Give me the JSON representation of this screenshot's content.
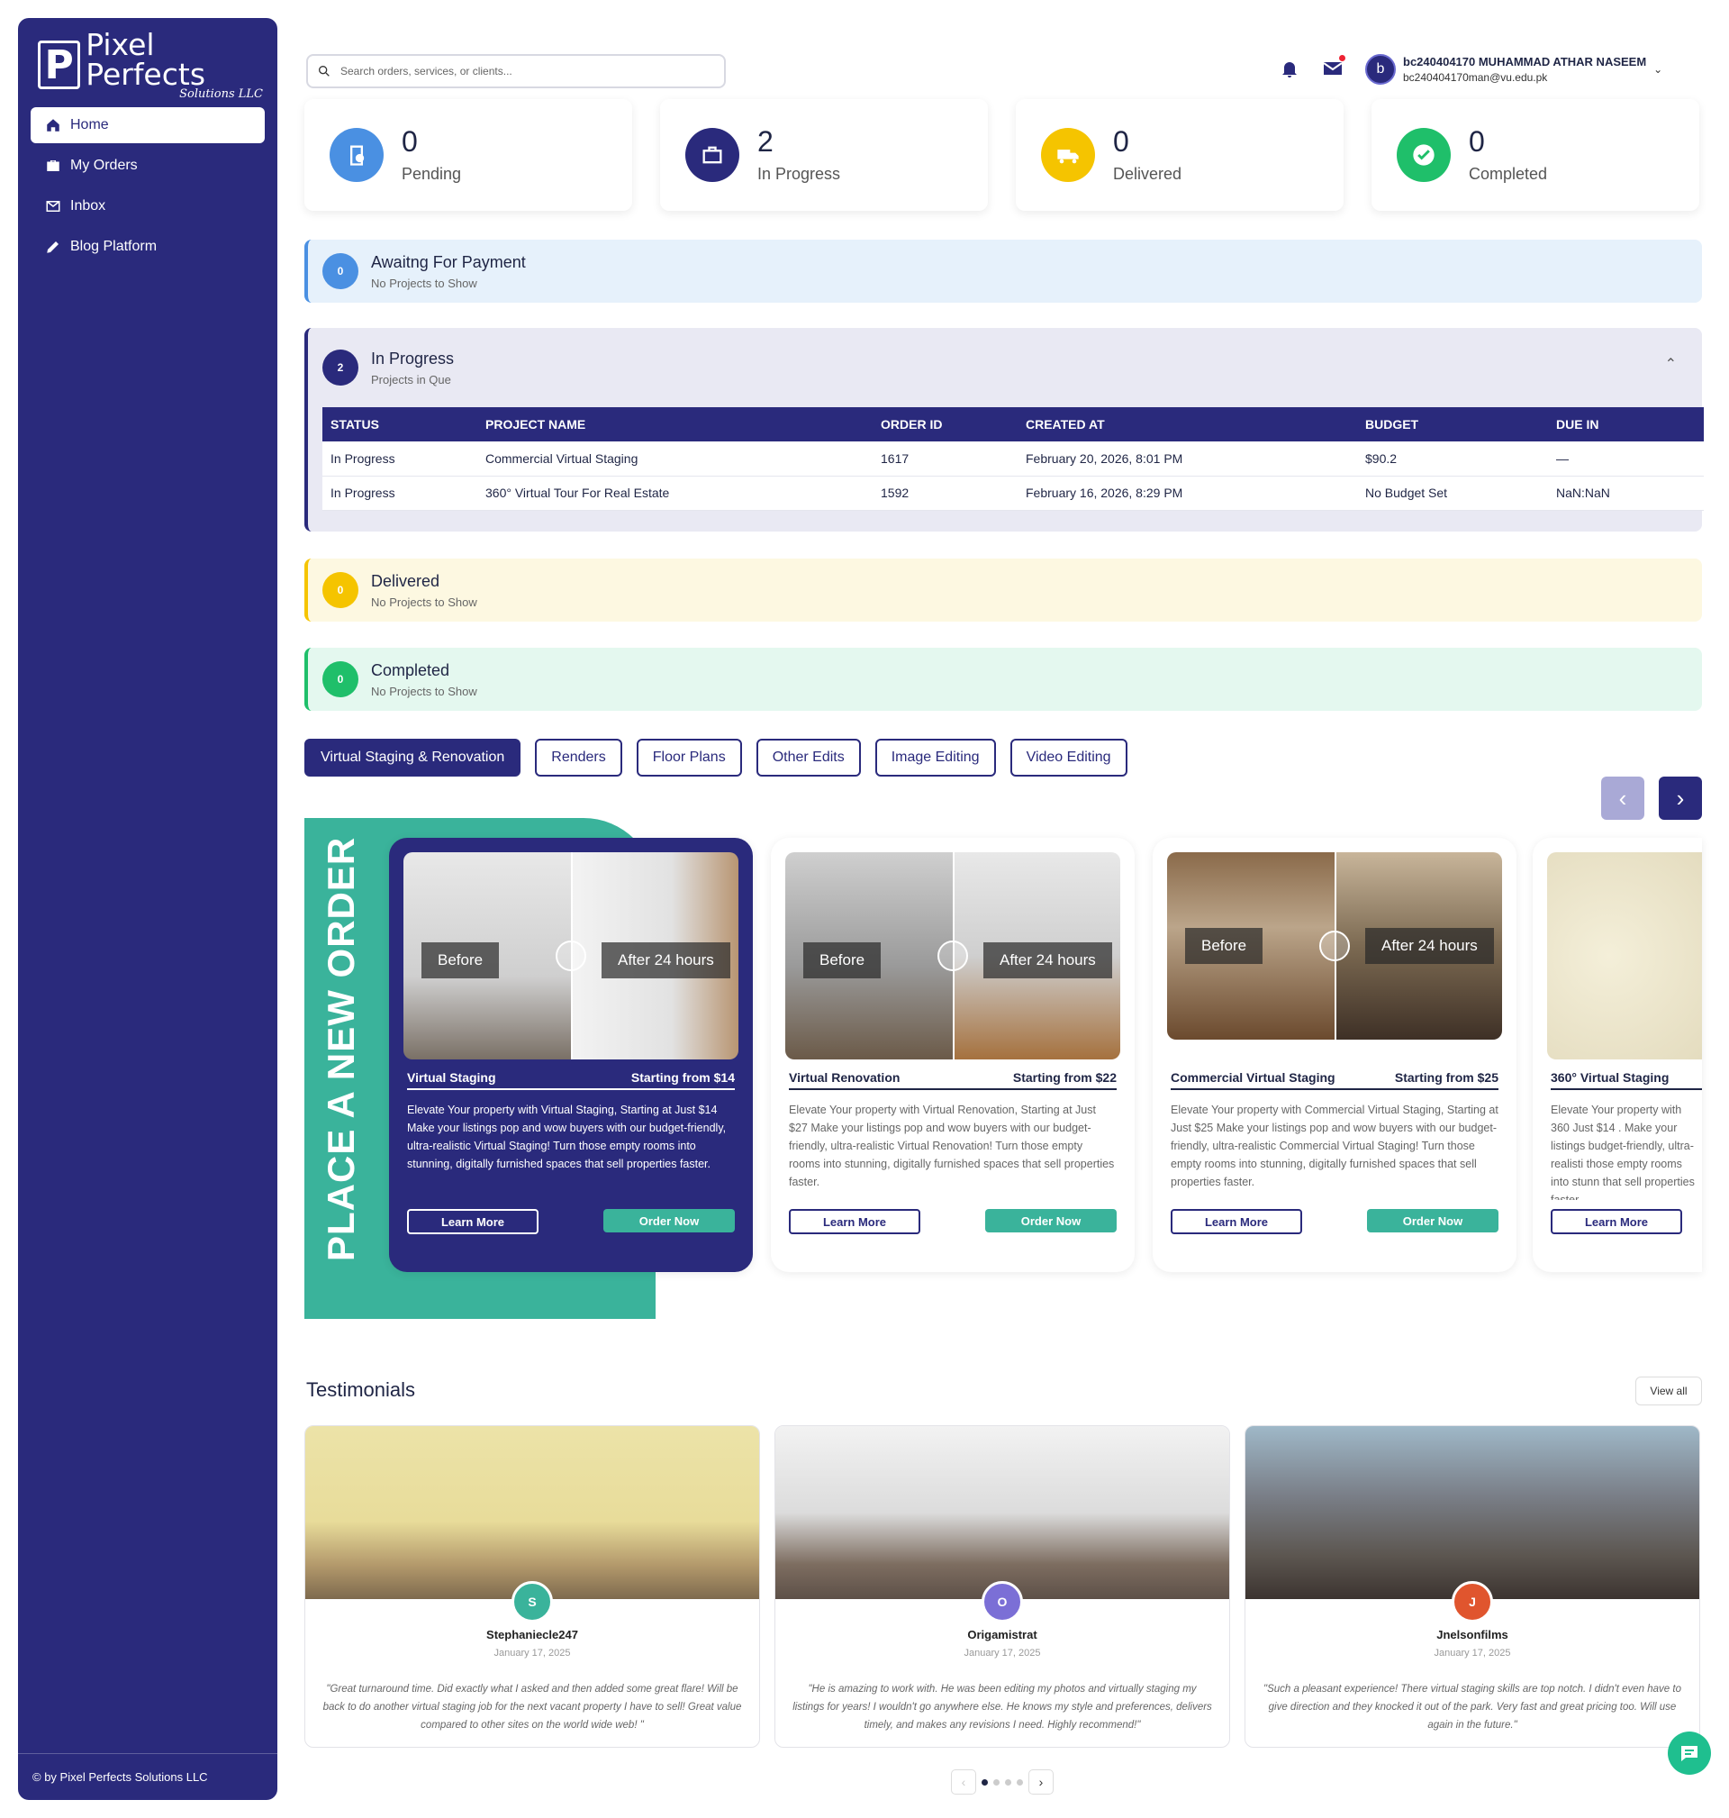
{
  "brand": {
    "name": "Pixel Perfects",
    "sub": "Solutions LLC",
    "mark": "P"
  },
  "sidebar": {
    "items": [
      {
        "label": "Home",
        "icon": "home-icon",
        "active": true
      },
      {
        "label": "My Orders",
        "icon": "briefcase-icon"
      },
      {
        "label": "Inbox",
        "icon": "inbox-icon"
      },
      {
        "label": "Blog Platform",
        "icon": "pencil-icon"
      }
    ],
    "footer": "© by Pixel Perfects Solutions LLC"
  },
  "search": {
    "placeholder": "Search orders, services, or clients..."
  },
  "user": {
    "initial": "b",
    "name": "bc240404170 MUHAMMAD ATHAR NASEEM",
    "email": "bc240404170man@vu.edu.pk"
  },
  "stats": [
    {
      "value": "0",
      "label": "Pending",
      "color": "#4a90e2",
      "icon": "clipboard-clock-icon"
    },
    {
      "value": "2",
      "label": "In Progress",
      "color": "#2a2a7c",
      "icon": "briefcase-icon"
    },
    {
      "value": "0",
      "label": "Delivered",
      "color": "#f5c400",
      "icon": "truck-icon"
    },
    {
      "value": "0",
      "label": "Completed",
      "color": "#1fbf6a",
      "icon": "check-circle-icon"
    }
  ],
  "panels": {
    "awaiting": {
      "count": "0",
      "title": "Awaitng For Payment",
      "sub": "No Projects to Show"
    },
    "progress": {
      "count": "2",
      "title": "In Progress",
      "sub": "Projects in Que"
    },
    "delivered": {
      "count": "0",
      "title": "Delivered",
      "sub": "No Projects to Show"
    },
    "completed": {
      "count": "0",
      "title": "Completed",
      "sub": "No Projects to Show"
    }
  },
  "table": {
    "headers": [
      "STATUS",
      "PROJECT NAME",
      "ORDER ID",
      "CREATED AT",
      "BUDGET",
      "DUE IN"
    ],
    "rows": [
      [
        "In Progress",
        "Commercial Virtual Staging",
        "1617",
        "February 20, 2026, 8:01 PM",
        "$90.2",
        "—"
      ],
      [
        "In Progress",
        "360° Virtual Tour For Real Estate",
        "1592",
        "February 16, 2026, 8:29 PM",
        "No Budget Set",
        "NaN:NaN"
      ]
    ]
  },
  "tabs": [
    "Virtual Staging & Renovation",
    "Renders",
    "Floor Plans",
    "Other Edits",
    "Image Editing",
    "Video Editing"
  ],
  "place_order": "PLACE A NEW ORDER",
  "services": [
    {
      "title": "Virtual Staging",
      "price": "Starting from $14",
      "before": "Before",
      "after": "After 24 hours",
      "desc": "Elevate Your property with Virtual Staging, Starting at Just $14 Make your listings pop and wow buyers with our budget-friendly, ultra-realistic Virtual Staging! Turn those empty rooms into stunning, digitally furnished spaces that sell properties faster.",
      "learn": "Learn More",
      "order": "Order Now"
    },
    {
      "title": "Virtual Renovation",
      "price": "Starting from $22",
      "before": "Before",
      "after": "After 24 hours",
      "desc": "Elevate Your property with Virtual Renovation, Starting at Just $27 Make your listings pop and wow buyers with our budget-friendly, ultra-realistic Virtual Renovation! Turn those empty rooms into stunning, digitally furnished spaces that sell properties faster.",
      "learn": "Learn More",
      "order": "Order Now"
    },
    {
      "title": "Commercial Virtual Staging",
      "price": "Starting from $25",
      "before": "Before",
      "after": "After 24 hours",
      "desc": "Elevate Your property with Commercial Virtual Staging, Starting at Just $25 Make your listings pop and wow buyers with our budget-friendly, ultra-realistic Commercial Virtual Staging! Turn those empty rooms into stunning, digitally furnished spaces that sell properties faster.",
      "learn": "Learn More",
      "order": "Order Now"
    },
    {
      "title": "360° Virtual Staging",
      "desc": "Elevate Your property with 360 Just $14 . Make your listings budget-friendly, ultra-realisti those empty rooms into stunn that sell properties faster.",
      "learn": "Learn More"
    }
  ],
  "testimonials": {
    "title": "Testimonials",
    "view_all": "View all",
    "items": [
      {
        "initial": "S",
        "color": "#3ab39b",
        "name": "Stephaniecle247",
        "date": "January 17, 2025",
        "quote": "\"Great turnaround time. Did exactly what I asked and then added some great flare! Will be back to do another virtual staging job for the next vacant property I have to sell! Great value compared to other sites on the world wide web! \""
      },
      {
        "initial": "O",
        "color": "#7b6fd6",
        "name": "Origamistrat",
        "date": "January 17, 2025",
        "quote": "\"He is amazing to work with. He was been editing my photos and virtually staging my listings for years! I wouldn't go anywhere else. He knows my style and preferences, delivers timely, and makes any revisions I need. Highly recommend!\""
      },
      {
        "initial": "J",
        "color": "#e0552e",
        "name": "Jnelsonfilms",
        "date": "January 17, 2025",
        "quote": "\"Such a pleasant experience! There virtual staging skills are top notch. I didn't even have to give direction and they knocked it out of the park. Very fast and great pricing too. Will use again in the future.\""
      }
    ]
  },
  "carousel": {
    "prev": "‹",
    "next": "›"
  }
}
